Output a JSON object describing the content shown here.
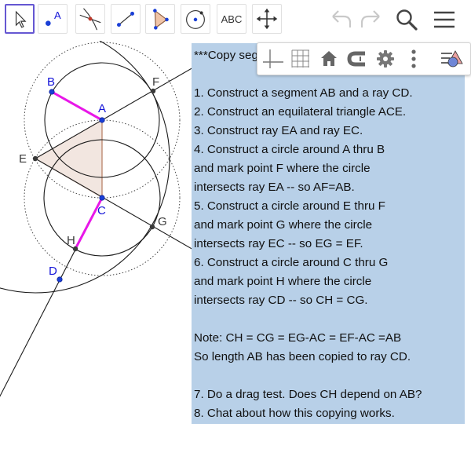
{
  "toolbar": {
    "tools": [
      {
        "name": "move-tool",
        "selected": true
      },
      {
        "name": "point-tool",
        "label": "A"
      },
      {
        "name": "intersect-tool"
      },
      {
        "name": "segment-tool"
      },
      {
        "name": "polygon-tool"
      },
      {
        "name": "circle-tool"
      },
      {
        "name": "text-tool",
        "label": "ABC"
      },
      {
        "name": "move-view-tool"
      }
    ],
    "right": [
      "undo-icon",
      "redo-icon",
      "search-icon",
      "menu-icon"
    ]
  },
  "style_bar": {
    "buttons": [
      "axes-icon",
      "grid-icon",
      "home-icon",
      "snap-icon",
      "gear-icon",
      "more-icon",
      "style-toggle-icon"
    ]
  },
  "construction": {
    "points": {
      "A": "A",
      "B": "B",
      "C": "C",
      "D": "D",
      "E": "E",
      "F": "F",
      "G": "G",
      "H": "H"
    },
    "colors": {
      "label": "#1515d8",
      "segment": "#e817e8",
      "triangle_fill": "#f2e6e0",
      "triangle_edge": "#b57a5e",
      "point": "#3a3a3a",
      "blue_point": "#1a3fd6"
    }
  },
  "text_panel": {
    "lines": [
      "***Copy segment AB onto ray CD.***",
      "",
      "1. Construct a segment AB and a ray CD.",
      "2. Construct an equilateral triangle ACE.",
      "3. Construct ray EA and ray EC.",
      "4. Construct a circle around A thru B",
      "and mark point F where the circle",
      "intersects ray EA -- so AF=AB.",
      "5. Construct a circle around E thru F",
      "and mark point G where the circle",
      "intersects ray EC -- so EG = EF.",
      "6. Construct a circle around C thru G",
      "and mark point H where the circle",
      "intersects ray CD -- so CH = CG.",
      "",
      "Note: CH = CG = EG-AC = EF-AC =AB",
      "So length AB has been copied to ray CD.",
      "",
      "7. Do a drag test. Does CH depend on AB?",
      "8. Chat about how this copying works."
    ]
  }
}
